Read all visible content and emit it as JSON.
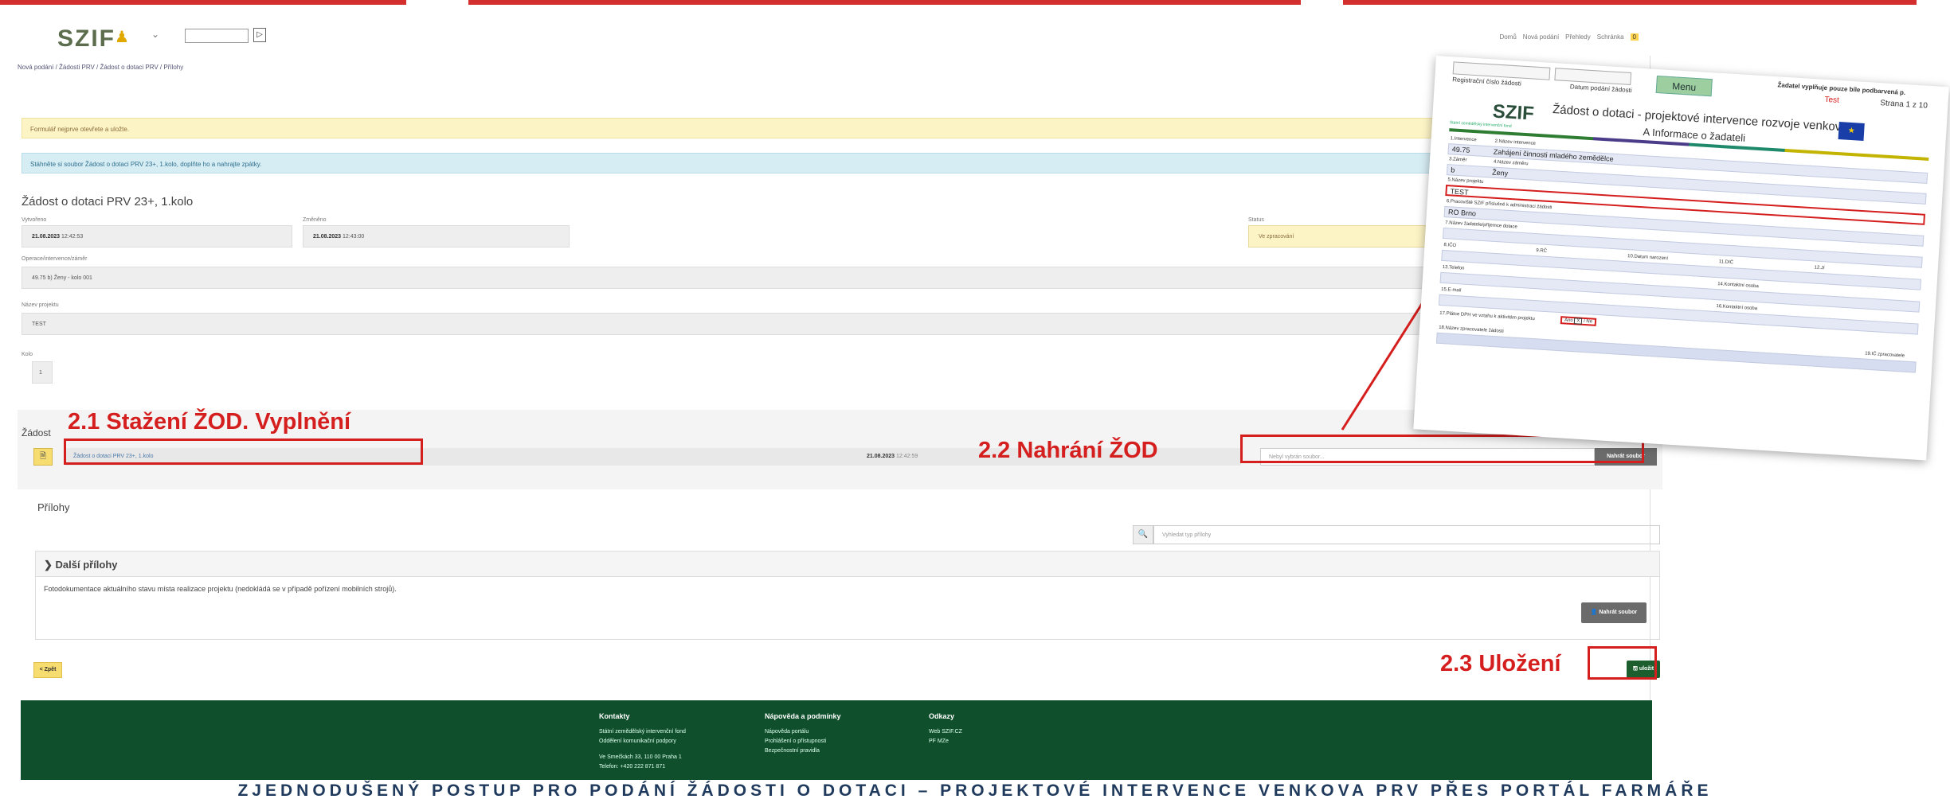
{
  "header": {
    "logo": "SZIF",
    "select_caret": "⌄",
    "go_button": "▷",
    "nav": [
      "Domů",
      "Nová podání",
      "Přehledy",
      "Schránka"
    ],
    "badge": "0"
  },
  "breadcrumb": "Nová podání / Žádosti PRV / Žádost o dotaci PRV / Přílohy",
  "banners": {
    "warning": "Formulář nejprve otevřete a uložte.",
    "info": "Stáhněte si soubor Žádost o dotaci PRV 23+, 1.kolo, doplňte ho a nahrajte zpátky."
  },
  "form": {
    "title": "Žádost o dotaci PRV 23+, 1.kolo",
    "created_label": "Vytvořeno",
    "created_date": "21.08.2023",
    "created_time": "12:42:53",
    "changed_label": "Změněno",
    "changed_date": "21.08.2023",
    "changed_time": "12:43:00",
    "status_label": "Status",
    "status_value": "Ve zpracování",
    "operation_label": "Operace/intervence/záměr",
    "operation_value": "49.75 b) Ženy - kolo 001",
    "project_label": "Název projektu",
    "project_value": "TEST",
    "round_label": "Kolo",
    "round_value": "1"
  },
  "zadost": {
    "label": "Žádost",
    "file_icon": "🗎",
    "file_link": "Žádost o dotaci PRV 23+, 1.kolo",
    "file_date": "21.08.2023",
    "file_time": "12:42:59",
    "upload_placeholder": "Nebyl vybrán soubor...",
    "upload_button": "Nahrát soubor"
  },
  "prilohy": {
    "title": "Přílohy",
    "search_icon": "🔍",
    "search_placeholder": "Vyhledat typ přílohy",
    "panel_title": "❯ Další přílohy",
    "panel_desc": "Fotodokumentace aktuálního stavu místa realizace projektu (nedokládá se v případě pořízení mobilních strojů).",
    "panel_button": "👤 Nahrát soubor"
  },
  "actions": {
    "back": "< Zpět",
    "save": "🖫 uložit"
  },
  "footer": {
    "col1_title": "Kontakty",
    "col1_lines": [
      "Státní zemědělský intervenční fond",
      "Oddělení komunikační podpory",
      "",
      "Ve Smečkách 33, 110 00 Praha 1",
      "Telefon: +420 222 871 871"
    ],
    "col2_title": "Nápověda a podmínky",
    "col2_lines": [
      "Nápověda portálu",
      "Prohlášení o přístupnosti",
      "Bezpečnostní pravidla"
    ],
    "col3_title": "Odkazy",
    "col3_lines": [
      "Web SZIF.CZ",
      "PF MZe"
    ]
  },
  "annotations": {
    "a1": "2.1  Stažení ŽOD. Vyplnění",
    "a2": "2.2  Nahrání ŽOD",
    "a3": "2.3 Uložení"
  },
  "doc": {
    "reg_label": "Registrační číslo žádosti",
    "date_label": "Datum podání žádosti",
    "menu": "Menu",
    "instr": "Žadatel vyplňuje pouze bíle podbarvená p.",
    "test": "Test",
    "page": "Strana 1 z 10",
    "logo": "SZIF",
    "logo_sub": "Státní zemědělský intervenční fond",
    "title": "Žádost o dotaci - projektové intervence rozvoje venkova",
    "subtitle": "A Informace o žadateli",
    "eu": "★",
    "h1": "1.Intervence",
    "h2": "2.Název intervence",
    "v1": "49.75",
    "v2": "Zahájení činnosti mladého zemědělce",
    "h3": "3.Záměr",
    "h4": "4.Název záměru",
    "v3": "b",
    "v4": "Ženy",
    "h5": "5.Název projektu",
    "v5": "TEST",
    "h6": "6.Pracoviště SZIF příslušné k administraci žádosti",
    "v6": "RO Brno",
    "h7": "7.Název žadatele/příjemce dotace",
    "h8": "8.IČO",
    "h9": "9.RČ",
    "h10": "10.Datum narození",
    "h11": "11.DIČ",
    "h12": "12.Jí",
    "h13": "13.Telefon",
    "h14": "14.Kontaktní osoba",
    "h15": "15.E-mail",
    "h16": "16.Kontaktní osoba",
    "h17": "17.Plátce DPH ve vztahu k aktivitám projektu",
    "ano": "Ano",
    "x": "X",
    "ne": "/  Ne",
    "h18": "18.Název zpracovatele žádosti",
    "h19": "19.IČ zpracovatele"
  },
  "caption": "ZJEDNODUŠENÝ POSTUP PRO PODÁNÍ ŽÁDOSTI O DOTACI – PROJEKTOVÉ INTERVENCE VENKOVA PRV PŘES PORTÁL FARMÁŘE",
  "colors": {
    "annotation_red": "#d51e1e",
    "footer_green": "#0f4f2c",
    "save_green": "#1d5e2f",
    "warning_bg": "#fdf4c6",
    "info_bg": "#d6edf4"
  }
}
